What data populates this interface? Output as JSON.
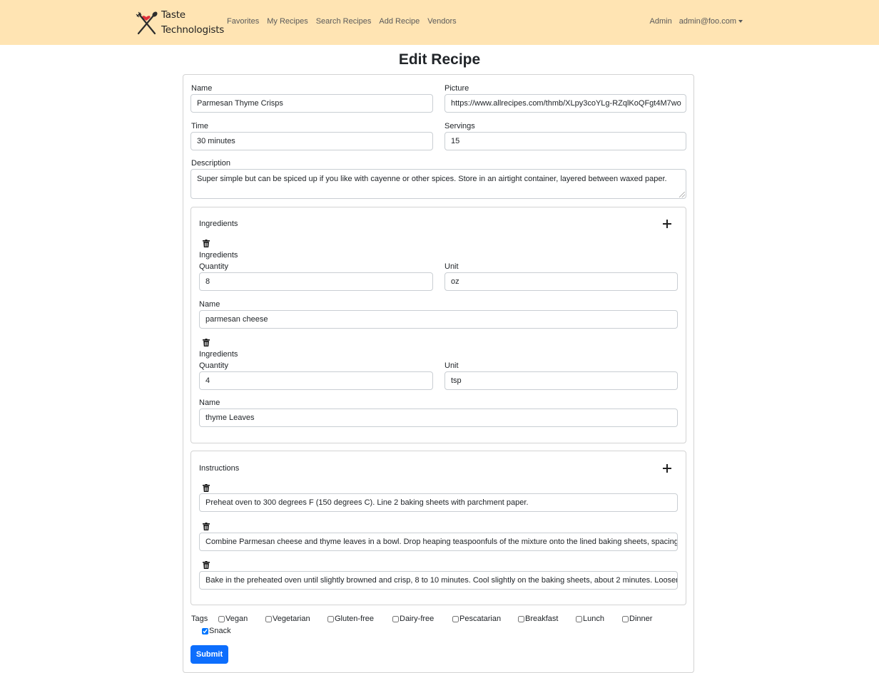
{
  "nav": {
    "brand_line1": "Taste",
    "brand_line2": "Technologists",
    "links": [
      "Favorites",
      "My Recipes",
      "Search Recipes",
      "Add Recipe",
      "Vendors"
    ],
    "admin": "Admin",
    "user": "admin@foo.com"
  },
  "title": "Edit Recipe",
  "form": {
    "name_label": "Name",
    "name_value": "Parmesan Thyme Crisps",
    "picture_label": "Picture",
    "picture_value": "https://www.allrecipes.com/thmb/XLpy3coYLg-RZqlKoQFgt4M7wo",
    "time_label": "Time",
    "time_value": "30 minutes",
    "servings_label": "Servings",
    "servings_value": "15",
    "description_label": "Description",
    "description_value": "Super simple but can be spiced up if you like with cayenne or other spices. Store in an airtight container, layered between waxed paper."
  },
  "ingredients": {
    "header": "Ingredients",
    "items": [
      {
        "label": "Ingredients",
        "quantity_label": "Quantity",
        "quantity": "8",
        "unit_label": "Unit",
        "unit": "oz",
        "name_label": "Name",
        "name": "parmesan cheese"
      },
      {
        "label": "Ingredients",
        "quantity_label": "Quantity",
        "quantity": "4",
        "unit_label": "Unit",
        "unit": "tsp",
        "name_label": "Name",
        "name": "thyme Leaves"
      }
    ]
  },
  "instructions": {
    "header": "Instructions",
    "steps": [
      "Preheat oven to 300 degrees F (150 degrees C). Line 2 baking sheets with parchment paper.",
      "Combine Parmesan cheese and thyme leaves in a bowl. Drop heaping teaspoonfuls of the mixture onto the lined baking sheets, spacing",
      "Bake in the preheated oven until slightly browned and crisp, 8 to 10 minutes. Cool slightly on the baking sheets, about 2 minutes. Loosen"
    ]
  },
  "tags": {
    "label": "Tags",
    "options": [
      {
        "name": "Vegan",
        "checked": false
      },
      {
        "name": "Vegetarian",
        "checked": false
      },
      {
        "name": "Gluten-free",
        "checked": false
      },
      {
        "name": "Dairy-free",
        "checked": false
      },
      {
        "name": "Pescatarian",
        "checked": false
      },
      {
        "name": "Breakfast",
        "checked": false
      },
      {
        "name": "Lunch",
        "checked": false
      },
      {
        "name": "Dinner",
        "checked": false
      },
      {
        "name": "Snack",
        "checked": true
      }
    ]
  },
  "submit_label": "Submit",
  "colors": {
    "navbar": "#ffe4b3",
    "primary": "#0d6efd",
    "heart": "#e0313a"
  }
}
